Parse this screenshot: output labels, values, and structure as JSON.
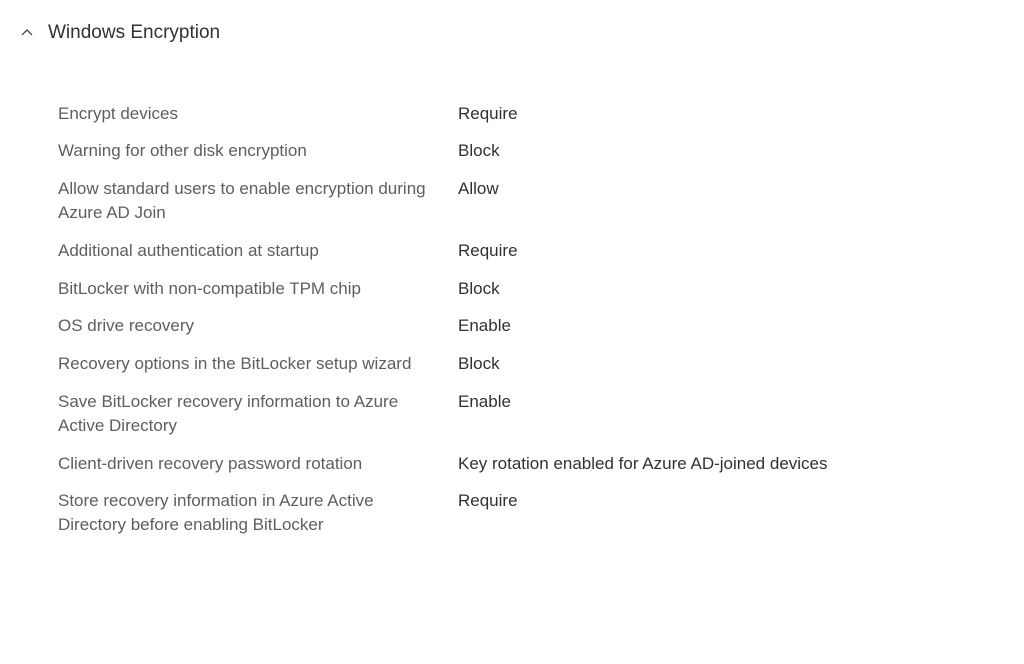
{
  "section": {
    "title": "Windows Encryption"
  },
  "settings": [
    {
      "label": "Encrypt devices",
      "value": "Require"
    },
    {
      "label": "Warning for other disk encryption",
      "value": "Block"
    },
    {
      "label": "Allow standard users to enable encryption during Azure AD Join",
      "value": "Allow"
    },
    {
      "label": "Additional authentication at startup",
      "value": "Require"
    },
    {
      "label": "BitLocker with non-compatible TPM chip",
      "value": "Block"
    },
    {
      "label": "OS drive recovery",
      "value": "Enable"
    },
    {
      "label": "Recovery options in the BitLocker setup wizard",
      "value": "Block"
    },
    {
      "label": "Save BitLocker recovery information to Azure Active Directory",
      "value": "Enable"
    },
    {
      "label": "Client-driven recovery password rotation",
      "value": "Key rotation enabled for Azure AD-joined devices"
    },
    {
      "label": "Store recovery information in Azure Active Directory before enabling BitLocker",
      "value": "Require"
    }
  ]
}
